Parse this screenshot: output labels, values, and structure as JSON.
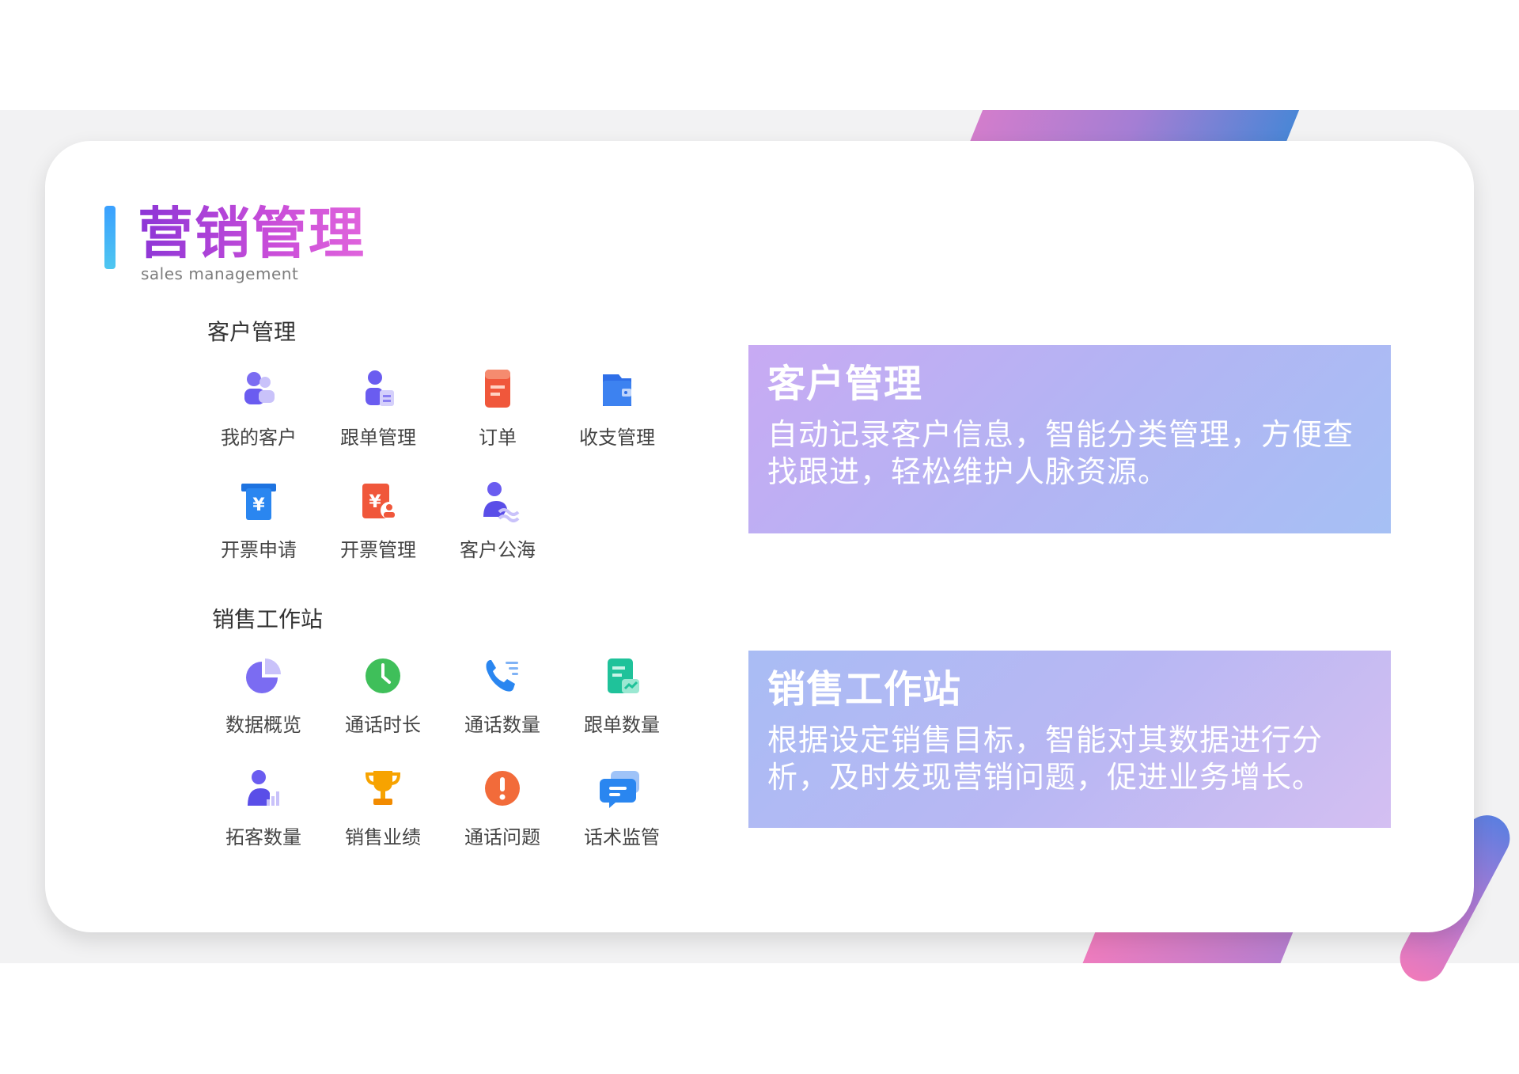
{
  "header": {
    "title": "营销管理",
    "subtitle": "sales management"
  },
  "customer_section": {
    "title": "客户管理",
    "items": [
      {
        "label": "我的客户",
        "icon": "user-group-icon"
      },
      {
        "label": "跟单管理",
        "icon": "user-doc-icon"
      },
      {
        "label": "订单",
        "icon": "order-doc-icon"
      },
      {
        "label": "收支管理",
        "icon": "wallet-icon"
      },
      {
        "label": "开票申请",
        "icon": "invoice-yuan-icon"
      },
      {
        "label": "开票管理",
        "icon": "invoice-user-icon"
      },
      {
        "label": "客户公海",
        "icon": "user-wave-icon"
      }
    ]
  },
  "sales_section": {
    "title": "销售工作站",
    "items": [
      {
        "label": "数据概览",
        "icon": "pie-chart-icon"
      },
      {
        "label": "通话时长",
        "icon": "clock-icon"
      },
      {
        "label": "通话数量",
        "icon": "phone-list-icon"
      },
      {
        "label": "跟单数量",
        "icon": "doc-chart-icon"
      },
      {
        "label": "拓客数量",
        "icon": "user-bars-icon"
      },
      {
        "label": "销售业绩",
        "icon": "trophy-icon"
      },
      {
        "label": "通话问题",
        "icon": "exclamation-icon"
      },
      {
        "label": "话术监管",
        "icon": "chat-lines-icon"
      }
    ]
  },
  "panels": [
    {
      "title": "客户管理",
      "lines": [
        "自动记录客户信息，智能分类管理，方便查",
        "找跟进，轻松维护人脉资源。"
      ]
    },
    {
      "title": "销售工作站",
      "lines": [
        "根据设定销售目标，智能对其数据进行分",
        "析，及时发现营销问题，促进业务增长。"
      ]
    }
  ],
  "colors": {
    "title_gradient_start": "#8c35d6",
    "title_gradient_end": "#e064dc",
    "accent_bar": "#3aa0ff",
    "panel_top": "#b8b4f3",
    "panel_bottom": "#b8bcf3"
  }
}
